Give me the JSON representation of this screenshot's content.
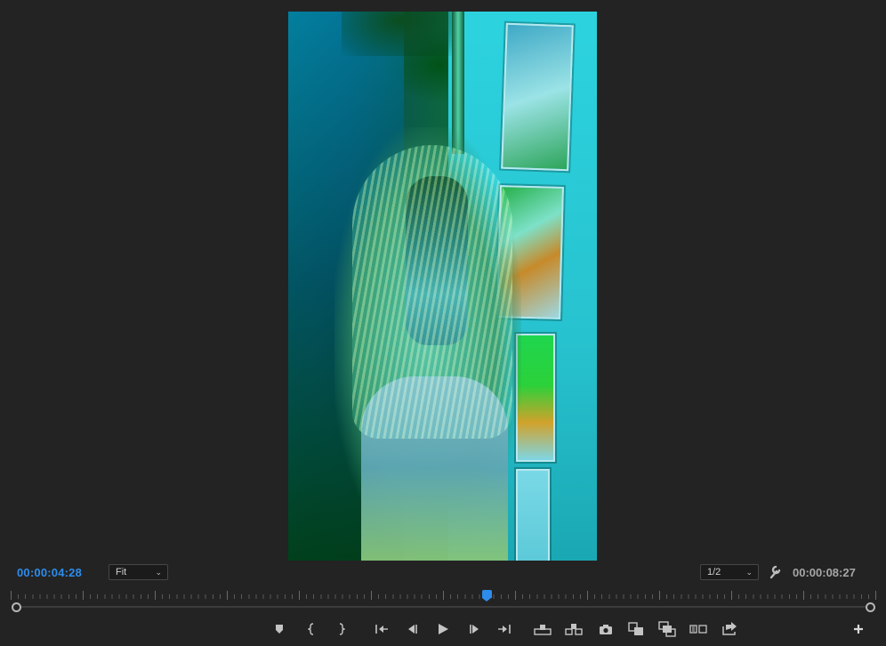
{
  "monitor": {
    "current_timecode": "00:00:04:28",
    "duration_timecode": "00:00:08:27",
    "zoom": "Fit",
    "resolution": "1/2",
    "timecode_color": "#2d8ceb",
    "playhead_position_fraction": 0.55
  },
  "controls": [
    {
      "name": "add-marker-button",
      "icon": "marker-icon"
    },
    {
      "name": "mark-in-button",
      "icon": "mark-in-icon"
    },
    {
      "name": "mark-out-button",
      "icon": "mark-out-icon"
    },
    {
      "name": "go-to-in-button",
      "icon": "go-to-in-icon"
    },
    {
      "name": "step-back-button",
      "icon": "step-back-icon"
    },
    {
      "name": "play-button",
      "icon": "play-icon"
    },
    {
      "name": "step-forward-button",
      "icon": "step-forward-icon"
    },
    {
      "name": "go-to-out-button",
      "icon": "go-to-out-icon"
    },
    {
      "name": "lift-button",
      "icon": "lift-icon"
    },
    {
      "name": "extract-button",
      "icon": "extract-icon"
    },
    {
      "name": "export-frame-button",
      "icon": "camera-icon"
    },
    {
      "name": "comparison-view-button",
      "icon": "comparison-icon"
    },
    {
      "name": "multi-camera-button",
      "icon": "multicam-icon"
    },
    {
      "name": "toggle-proxies-button",
      "icon": "proxy-icon"
    },
    {
      "name": "export-button",
      "icon": "export-icon"
    },
    {
      "name": "button-editor-button",
      "icon": "plus-icon"
    }
  ]
}
